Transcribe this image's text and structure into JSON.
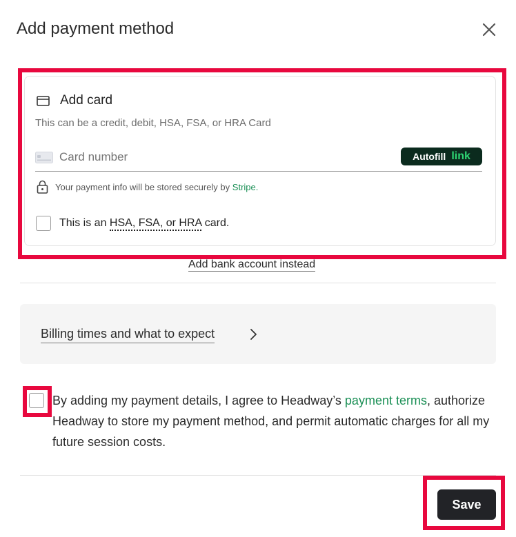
{
  "dialog": {
    "title": "Add payment method",
    "close_icon": "close-icon"
  },
  "card": {
    "heading": "Add card",
    "heading_icon": "credit-card-icon",
    "subtitle": "This can be a credit, debit, HSA, FSA, or HRA Card",
    "card_number_placeholder": "Card number",
    "autofill_label": "Autofill",
    "autofill_link": "link",
    "secure_text": "Your payment info will be stored securely by",
    "secure_link": "Stripe.",
    "hsa_prefix": "This is an",
    "hsa_dotted": "HSA, FSA, or HRA",
    "hsa_suffix": "card."
  },
  "bank_link": "Add bank account instead",
  "billing": {
    "label": "Billing times and what to expect"
  },
  "agreement": {
    "prefix": "By adding my payment details, I agree to Headway’s",
    "terms_link": "payment terms",
    "suffix": ", authorize Headway to store my payment method, and permit automatic charges for all my future session costs."
  },
  "footer": {
    "save_label": "Save"
  },
  "colors": {
    "highlight": "#e8083e",
    "link_green": "#1a8f55",
    "save_bg": "#222327",
    "autofill_bg": "#0b2b1e"
  }
}
